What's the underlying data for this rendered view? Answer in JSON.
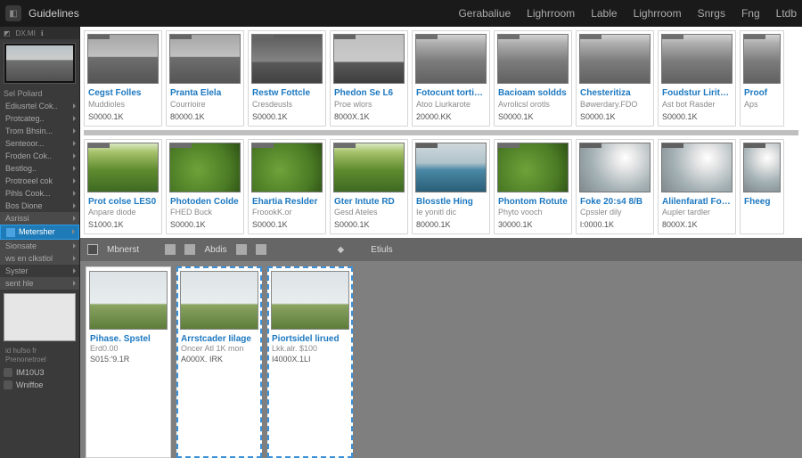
{
  "app": {
    "title": "Guidelines"
  },
  "topnav": [
    "Gerabaliue",
    "Lighrroom",
    "Lable",
    "Lighrroom",
    "Snrgs",
    "Fng",
    "Ltdb"
  ],
  "sidebar": {
    "preview_section": "Sel Poliard",
    "items": [
      "Ediusrtel Cok..",
      "Protcateg..",
      "Trom Bhsin...",
      "Senteoor...",
      "Froden Cok..",
      "Bestlog..",
      "Protroeel cok",
      "Pihls Cook...",
      "Bos Dione"
    ],
    "group1_label": "Asrissi",
    "highlight_label": "Metersher",
    "group2": [
      "Sionsate",
      "ws en clkstlol"
    ],
    "group3_label": "Syster",
    "group3_item": "sent hle",
    "footer_caption": "id hufso fr Prenonetroel",
    "footer_items": [
      "IM10U3",
      "Wniffoe"
    ]
  },
  "row1": [
    {
      "title": "Cegst Folles",
      "sub": "Muddioles",
      "size": "S0000.1K",
      "thumb": "t-sky"
    },
    {
      "title": "Pranta Elela",
      "sub": "Courrioire",
      "size": "80000.1K",
      "thumb": "t-sky"
    },
    {
      "title": "Restw Fottcle",
      "sub": "Cresdeusls",
      "size": "S0000.1K",
      "thumb": "t-dark"
    },
    {
      "title": "Phedon Se L6",
      "sub": "Proe wlors",
      "size": "8000X.1K",
      "thumb": "t-water"
    },
    {
      "title": "Fotocunt torticis",
      "sub": "Atoo Liurkarote",
      "size": "20000.KK",
      "thumb": "t-tree"
    },
    {
      "title": "Bacioam soldds",
      "sub": "Avrolicsl orotls",
      "size": "S0000.1K",
      "thumb": "t-tree"
    },
    {
      "title": "Chesteritiza",
      "sub": "Bøwerdary.FDO",
      "size": "S0000.1K",
      "thumb": "t-tree"
    },
    {
      "title": "Foudstur Liritoire",
      "sub": "Ast bot Rasder",
      "size": "S0000.1K",
      "thumb": "t-tree"
    },
    {
      "title": "Proof",
      "sub": "Aps",
      "size": "",
      "thumb": "t-tree"
    }
  ],
  "row2": [
    {
      "title": "Prot colse LES0",
      "sub": "Anpare diode",
      "size": "S1000.1K",
      "thumb": "t-tree"
    },
    {
      "title": "Photoden Colde",
      "sub": "FHED Buck",
      "size": "S0000.1K",
      "thumb": "t-green"
    },
    {
      "title": "Ehartia Reslder",
      "sub": "FroookK.or",
      "size": "S0000.1K",
      "thumb": "t-green"
    },
    {
      "title": "Gter Intute RD",
      "sub": "Gesd Ateles",
      "size": "S0000.1K",
      "thumb": "t-tree"
    },
    {
      "title": "Blosstle Hing",
      "sub": "Ie yonitl dic",
      "size": "80000.1K",
      "thumb": "t-lake"
    },
    {
      "title": "Phontom Rotute",
      "sub": "Phyto vooch",
      "size": "30000.1K",
      "thumb": "t-green"
    },
    {
      "title": "Foke 20:s4 8/B",
      "sub": "Cpssler dily",
      "size": "l:0000.1K",
      "thumb": "t-sun"
    },
    {
      "title": "Alilenfaratl Folee",
      "sub": "Aupler tardler",
      "size": "8000X.1K",
      "thumb": "t-sun"
    },
    {
      "title": "Fheeg",
      "sub": "",
      "size": " ",
      "thumb": "t-sun"
    }
  ],
  "midbar": {
    "label1": "Mbnerst",
    "label2": "Abdis",
    "label3": "Etiuls"
  },
  "tray": [
    {
      "title": "Pihase. Spstel",
      "sub": "Erd0.00",
      "size": "S015:'9.1R",
      "thumb": "t-field",
      "sel": false
    },
    {
      "title": "Arrstcader Iilage",
      "sub": "Oncer Atl 1K mon",
      "size": "A000X. IRK",
      "thumb": "t-field",
      "sel": true
    },
    {
      "title": "Piortsidel lirued",
      "sub": "Lkk.alr. $100",
      "size": "I4000X.1LI",
      "thumb": "t-field",
      "sel": true
    }
  ]
}
